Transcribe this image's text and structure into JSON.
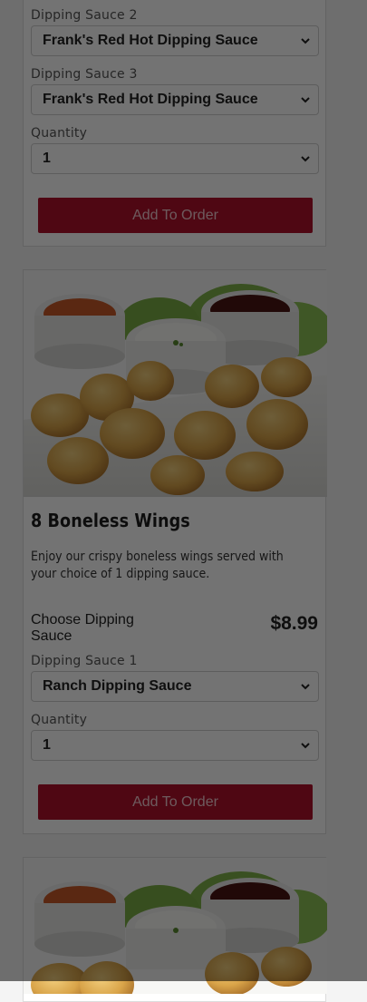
{
  "card_top": {
    "dipping_sauce_2_label": "Dipping Sauce 2",
    "dipping_sauce_2_value": "Frank's Red Hot Dipping Sauce",
    "dipping_sauce_3_label": "Dipping Sauce 3",
    "dipping_sauce_3_value": "Frank's Red Hot Dipping Sauce",
    "quantity_label": "Quantity",
    "quantity_value": "1",
    "add_button": "Add To Order"
  },
  "card_boneless": {
    "title": "8 Boneless Wings",
    "description": "Enjoy our crispy boneless wings served with your choice of 1 dipping sauce.",
    "choose_label": "Choose Dipping Sauce",
    "price": "$8.99",
    "dipping_sauce_1_label": "Dipping Sauce 1",
    "dipping_sauce_1_value": "Ranch Dipping Sauce",
    "quantity_label": "Quantity",
    "quantity_value": "1",
    "add_button": "Add To Order",
    "image_icon": "boneless-wings-photo"
  },
  "card_next": {
    "image_icon": "boneless-wings-photo"
  },
  "colors": {
    "brand_red": "#b0102a",
    "modal_overlay": "rgba(0,0,0,0.55)"
  }
}
